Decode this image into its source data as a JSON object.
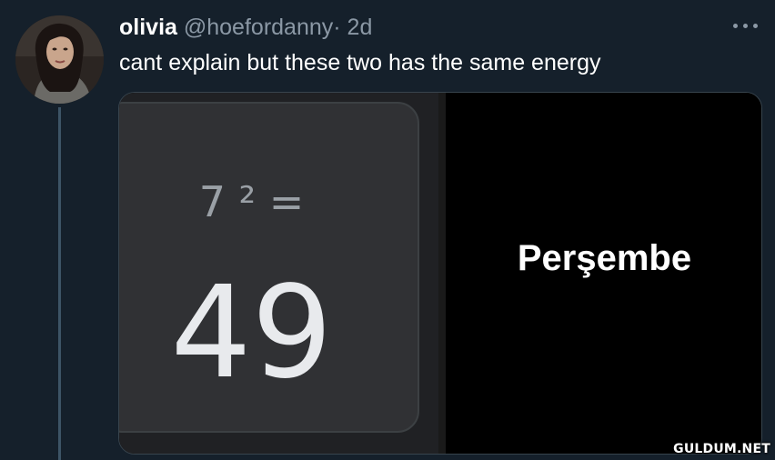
{
  "tweet": {
    "display_name": "olivia",
    "handle": "@hoefordanny",
    "separator": "·",
    "age": "2d",
    "text": "cant explain but these two has the same energy",
    "more_icon": "more-dots-icon"
  },
  "media": {
    "calculator": {
      "expression": "7 ² =",
      "result": "49"
    },
    "day_card": {
      "text": "Perşembe"
    }
  },
  "watermark": "GULDUM.NET",
  "colors": {
    "background": "#15202b",
    "thread_line": "#3d5466",
    "secondary_text": "#8b98a5",
    "primary_text": "#ffffff"
  }
}
